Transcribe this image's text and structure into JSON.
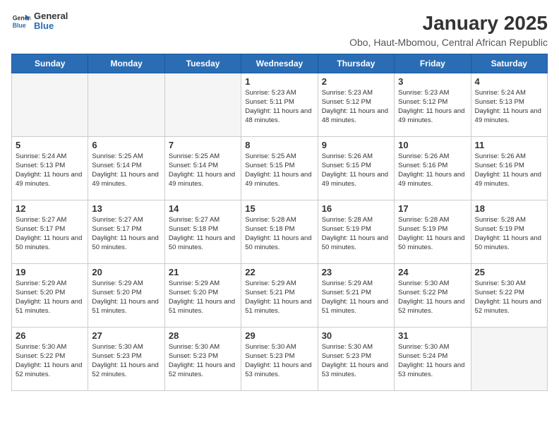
{
  "header": {
    "logo_general": "General",
    "logo_blue": "Blue",
    "title": "January 2025",
    "subtitle": "Obo, Haut-Mbomou, Central African Republic"
  },
  "columns": [
    "Sunday",
    "Monday",
    "Tuesday",
    "Wednesday",
    "Thursday",
    "Friday",
    "Saturday"
  ],
  "weeks": [
    [
      {
        "day": "",
        "empty": true
      },
      {
        "day": "",
        "empty": true
      },
      {
        "day": "",
        "empty": true
      },
      {
        "day": "1",
        "sunrise": "Sunrise: 5:23 AM",
        "sunset": "Sunset: 5:11 PM",
        "daylight": "Daylight: 11 hours and 48 minutes."
      },
      {
        "day": "2",
        "sunrise": "Sunrise: 5:23 AM",
        "sunset": "Sunset: 5:12 PM",
        "daylight": "Daylight: 11 hours and 48 minutes."
      },
      {
        "day": "3",
        "sunrise": "Sunrise: 5:23 AM",
        "sunset": "Sunset: 5:12 PM",
        "daylight": "Daylight: 11 hours and 49 minutes."
      },
      {
        "day": "4",
        "sunrise": "Sunrise: 5:24 AM",
        "sunset": "Sunset: 5:13 PM",
        "daylight": "Daylight: 11 hours and 49 minutes."
      }
    ],
    [
      {
        "day": "5",
        "sunrise": "Sunrise: 5:24 AM",
        "sunset": "Sunset: 5:13 PM",
        "daylight": "Daylight: 11 hours and 49 minutes."
      },
      {
        "day": "6",
        "sunrise": "Sunrise: 5:25 AM",
        "sunset": "Sunset: 5:14 PM",
        "daylight": "Daylight: 11 hours and 49 minutes."
      },
      {
        "day": "7",
        "sunrise": "Sunrise: 5:25 AM",
        "sunset": "Sunset: 5:14 PM",
        "daylight": "Daylight: 11 hours and 49 minutes."
      },
      {
        "day": "8",
        "sunrise": "Sunrise: 5:25 AM",
        "sunset": "Sunset: 5:15 PM",
        "daylight": "Daylight: 11 hours and 49 minutes."
      },
      {
        "day": "9",
        "sunrise": "Sunrise: 5:26 AM",
        "sunset": "Sunset: 5:15 PM",
        "daylight": "Daylight: 11 hours and 49 minutes."
      },
      {
        "day": "10",
        "sunrise": "Sunrise: 5:26 AM",
        "sunset": "Sunset: 5:16 PM",
        "daylight": "Daylight: 11 hours and 49 minutes."
      },
      {
        "day": "11",
        "sunrise": "Sunrise: 5:26 AM",
        "sunset": "Sunset: 5:16 PM",
        "daylight": "Daylight: 11 hours and 49 minutes."
      }
    ],
    [
      {
        "day": "12",
        "sunrise": "Sunrise: 5:27 AM",
        "sunset": "Sunset: 5:17 PM",
        "daylight": "Daylight: 11 hours and 50 minutes."
      },
      {
        "day": "13",
        "sunrise": "Sunrise: 5:27 AM",
        "sunset": "Sunset: 5:17 PM",
        "daylight": "Daylight: 11 hours and 50 minutes."
      },
      {
        "day": "14",
        "sunrise": "Sunrise: 5:27 AM",
        "sunset": "Sunset: 5:18 PM",
        "daylight": "Daylight: 11 hours and 50 minutes."
      },
      {
        "day": "15",
        "sunrise": "Sunrise: 5:28 AM",
        "sunset": "Sunset: 5:18 PM",
        "daylight": "Daylight: 11 hours and 50 minutes."
      },
      {
        "day": "16",
        "sunrise": "Sunrise: 5:28 AM",
        "sunset": "Sunset: 5:19 PM",
        "daylight": "Daylight: 11 hours and 50 minutes."
      },
      {
        "day": "17",
        "sunrise": "Sunrise: 5:28 AM",
        "sunset": "Sunset: 5:19 PM",
        "daylight": "Daylight: 11 hours and 50 minutes."
      },
      {
        "day": "18",
        "sunrise": "Sunrise: 5:28 AM",
        "sunset": "Sunset: 5:19 PM",
        "daylight": "Daylight: 11 hours and 50 minutes."
      }
    ],
    [
      {
        "day": "19",
        "sunrise": "Sunrise: 5:29 AM",
        "sunset": "Sunset: 5:20 PM",
        "daylight": "Daylight: 11 hours and 51 minutes."
      },
      {
        "day": "20",
        "sunrise": "Sunrise: 5:29 AM",
        "sunset": "Sunset: 5:20 PM",
        "daylight": "Daylight: 11 hours and 51 minutes."
      },
      {
        "day": "21",
        "sunrise": "Sunrise: 5:29 AM",
        "sunset": "Sunset: 5:20 PM",
        "daylight": "Daylight: 11 hours and 51 minutes."
      },
      {
        "day": "22",
        "sunrise": "Sunrise: 5:29 AM",
        "sunset": "Sunset: 5:21 PM",
        "daylight": "Daylight: 11 hours and 51 minutes."
      },
      {
        "day": "23",
        "sunrise": "Sunrise: 5:29 AM",
        "sunset": "Sunset: 5:21 PM",
        "daylight": "Daylight: 11 hours and 51 minutes."
      },
      {
        "day": "24",
        "sunrise": "Sunrise: 5:30 AM",
        "sunset": "Sunset: 5:22 PM",
        "daylight": "Daylight: 11 hours and 52 minutes."
      },
      {
        "day": "25",
        "sunrise": "Sunrise: 5:30 AM",
        "sunset": "Sunset: 5:22 PM",
        "daylight": "Daylight: 11 hours and 52 minutes."
      }
    ],
    [
      {
        "day": "26",
        "sunrise": "Sunrise: 5:30 AM",
        "sunset": "Sunset: 5:22 PM",
        "daylight": "Daylight: 11 hours and 52 minutes."
      },
      {
        "day": "27",
        "sunrise": "Sunrise: 5:30 AM",
        "sunset": "Sunset: 5:23 PM",
        "daylight": "Daylight: 11 hours and 52 minutes."
      },
      {
        "day": "28",
        "sunrise": "Sunrise: 5:30 AM",
        "sunset": "Sunset: 5:23 PM",
        "daylight": "Daylight: 11 hours and 52 minutes."
      },
      {
        "day": "29",
        "sunrise": "Sunrise: 5:30 AM",
        "sunset": "Sunset: 5:23 PM",
        "daylight": "Daylight: 11 hours and 53 minutes."
      },
      {
        "day": "30",
        "sunrise": "Sunrise: 5:30 AM",
        "sunset": "Sunset: 5:23 PM",
        "daylight": "Daylight: 11 hours and 53 minutes."
      },
      {
        "day": "31",
        "sunrise": "Sunrise: 5:30 AM",
        "sunset": "Sunset: 5:24 PM",
        "daylight": "Daylight: 11 hours and 53 minutes."
      },
      {
        "day": "",
        "empty": true
      }
    ]
  ]
}
